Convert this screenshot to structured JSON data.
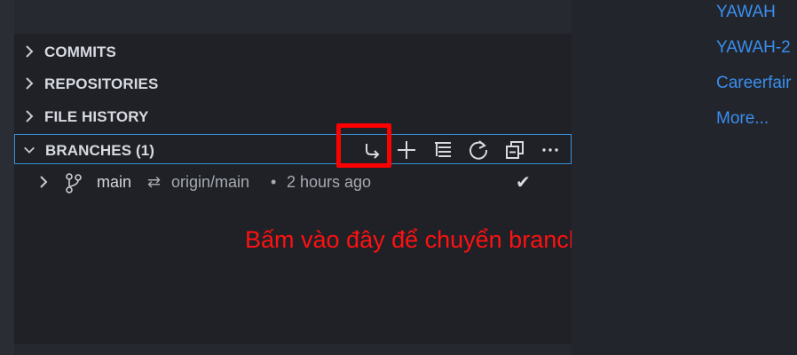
{
  "sections": [
    {
      "label": "COMMITS",
      "icon": "chevron-right-icon"
    },
    {
      "label": "REPOSITORIES",
      "icon": "chevron-right-icon"
    },
    {
      "label": "FILE HISTORY",
      "icon": "chevron-right-icon"
    }
  ],
  "branches": {
    "title": "BRANCHES (1)",
    "icon": "chevron-down-icon",
    "actions": [
      "switch-branch-icon",
      "add-icon",
      "list-tree-icon",
      "refresh-icon",
      "collapse-all-icon",
      "more-icon"
    ],
    "items": [
      {
        "name": "main",
        "sync_icon": "⇄",
        "upstream": "origin/main",
        "separator": "•",
        "time": "2 hours ago",
        "status": "✔"
      }
    ]
  },
  "annotation": "Bấm vào đây để chuyển branch",
  "right_panel": {
    "links": [
      "YAWAH",
      "YAWAH-2",
      "Careerfair",
      "More..."
    ]
  },
  "colors": {
    "background": "#1f2127",
    "accent_border": "#3792d8",
    "highlight": "#ff0000",
    "link": "#3a8ef0",
    "annotation": "#ff1111"
  }
}
